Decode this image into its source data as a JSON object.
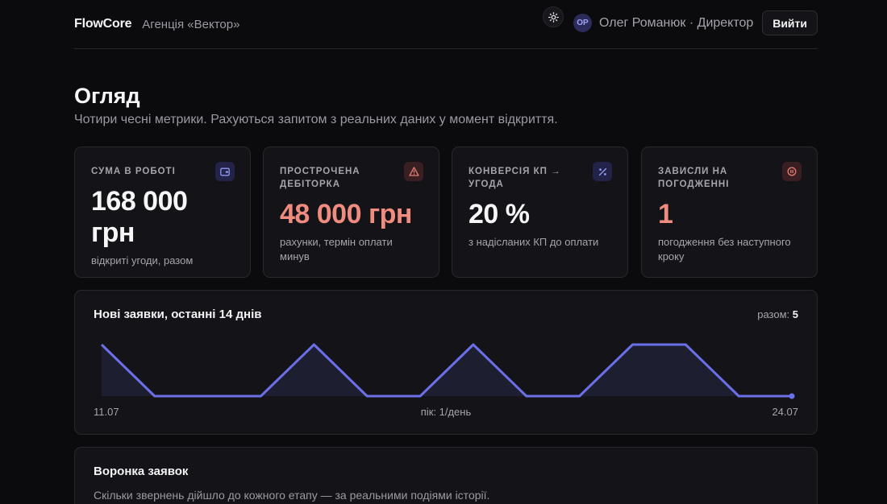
{
  "header": {
    "brand": "FlowCore",
    "agency": "Агенція «Вектор»",
    "theme_icon": "sun-icon",
    "user_initials": "ОР",
    "user_label": "Олег Романюк · Директор",
    "logout_label": "Вийти"
  },
  "page": {
    "title": "Огляд",
    "subtitle": "Чотири чесні метрики. Рахуються запитом з реальних даних у момент відкриття."
  },
  "metrics": [
    {
      "label": "СУМА В РОБОТІ",
      "value": "168 000 грн",
      "note": "відкриті угоди, разом",
      "icon": "wallet-icon",
      "accent": "#8f97f2"
    },
    {
      "label": "ПРОСТРОЧЕНА ДЕБІТОРКА",
      "value": "48 000 грн",
      "note": "рахунки, термін оплати минув",
      "icon": "warning-icon",
      "accent": "#ef8b7f"
    },
    {
      "label": "КОНВЕРСІЯ КП → УГОДА",
      "value": "20 %",
      "note": "з надісланих КП до оплати",
      "icon": "percent-icon",
      "accent": "#8f97f2"
    },
    {
      "label": "ЗАВИСЛИ НА ПОГОДЖЕННІ",
      "value": "1",
      "note": "погодження без наступного кроку",
      "icon": "pause-icon",
      "accent": "#ef8b7f"
    }
  ],
  "chart": {
    "title": "Нові заявки, останні 14 днів",
    "total_label": "разом:",
    "total_value": "5",
    "x_start": "11.07",
    "peak_label": "пік: 1/день",
    "x_end": "24.07"
  },
  "chart_data": {
    "type": "area",
    "x": [
      "11.07",
      "12.07",
      "13.07",
      "14.07",
      "15.07",
      "16.07",
      "17.07",
      "18.07",
      "19.07",
      "20.07",
      "21.07",
      "22.07",
      "23.07",
      "24.07"
    ],
    "values": [
      1,
      0,
      0,
      0,
      1,
      0,
      0,
      1,
      0,
      0,
      1,
      1,
      0,
      0
    ],
    "ylim": [
      0,
      1
    ],
    "color": "#6b6fe8"
  },
  "funnel": {
    "title": "Воронка заявок",
    "subtitle": "Скільки звернень дійшло до кожного етапу — за реальними подіями історії."
  }
}
